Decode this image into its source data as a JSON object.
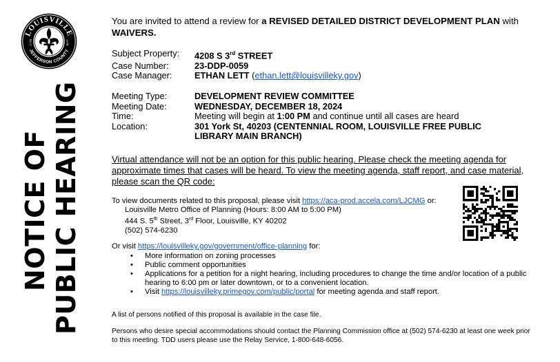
{
  "seal": {
    "name": "LOUISVILLE",
    "county": "JEFFERSON COUNTY",
    "year_left": "1778",
    "year_right": "1778"
  },
  "title": {
    "line1": "NOTICE OF",
    "line2": "PUBLIC HEARING"
  },
  "intro": {
    "prefix": "You are invited to attend a review for ",
    "bold": "a REVISED DETAILED DISTRICT DEVELOPMENT PLAN",
    "mid": " with ",
    "bold2": "WAIVERS."
  },
  "property": {
    "subject_label": "Subject Property:",
    "subject_num": "4208 S 3",
    "subject_sup": "rd",
    "subject_rest": " STREET",
    "case_number_label": "Case Number:",
    "case_number": "23-DDP-0059",
    "case_manager_label": "Case Manager:",
    "case_manager": "ETHAN LETT",
    "case_manager_email_open": " (",
    "case_manager_email": "ethan.lett@louisvilleky.gov",
    "case_manager_email_close": ")"
  },
  "meeting": {
    "type_label": "Meeting Type:",
    "type": "DEVELOPMENT REVIEW COMMITTEE",
    "date_label": "Meeting Date:",
    "date": "WEDNESDAY, DECEMBER 18, 2024",
    "time_label": "Time:",
    "time_prefix": "Meeting will begin at ",
    "time_bold": "1:00 PM",
    "time_suffix": " and continue until all cases are heard",
    "location_label": "Location:",
    "location": "301 York St, 40203 (CENTENNIAL ROOM, LOUISVILLE FREE PUBLIC LIBRARY MAIN BRANCH)"
  },
  "virtual_note": "Virtual attendance will not be an option for this public hearing. Please check the meeting agenda for approximate times that cases will be heard. To view the meeting agenda, staff report, and case material, please scan the QR code:",
  "documents": {
    "prefix": "To view documents related to this proposal, please visit ",
    "link": "https://aca-prod.accela.com/LJCMG",
    "suffix": " or:",
    "office": "Louisville Metro Office of Planning (Hours: 8:00 AM to 5:00 PM)",
    "address_a": "444 S. 5",
    "address_sup_a": "th",
    "address_b": " Street, 3",
    "address_sup_b": "rd",
    "address_c": " Floor, Louisville, KY 40202",
    "phone": "(502) 574-6230"
  },
  "or_visit": {
    "prefix": "Or visit ",
    "link": "https://louisvilleky.gov/government/office-planning",
    "suffix": " for:",
    "bullet": "•",
    "item1": "More information on zoning processes",
    "item2": "Public comment opportunities",
    "item3": "Applications for a petition for a night hearing, including procedures to change the time and/or location of a public hearing to 6:00 pm or later downtown, or to a convenient location.",
    "item4_prefix": "Visit ",
    "item4_link": "https://louisvilleky.primegov.com/public/portal",
    "item4_suffix": " for meeting agenda and staff report."
  },
  "list_note": "A list of persons notified of this proposal is available in the case file.",
  "accommodations": "Persons who desire special accommodations should contact the Planning Commission office at (502) 574-6230 at least one week prior to this meeting. TDD users please use the Relay Service, 1-800-648-6056."
}
